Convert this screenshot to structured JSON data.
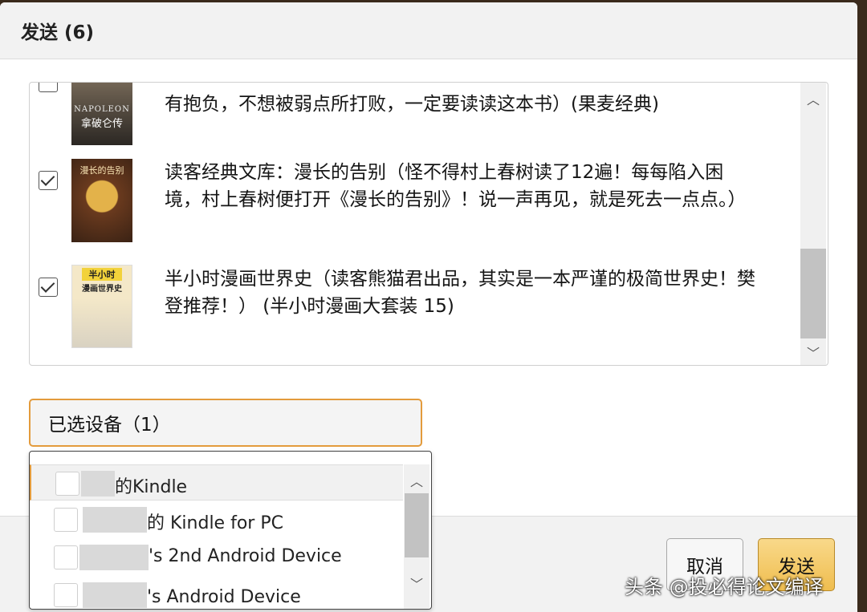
{
  "dialog": {
    "title": "发送 (6)"
  },
  "books": [
    {
      "title": "有抱负，不想被弱点所打败，一定要读读这本书）(果麦经典)",
      "checked": false,
      "cover_top": "NAPOLEON",
      "cover_bottom": "拿破仑传"
    },
    {
      "title": "读客经典文库：漫长的告别（怪不得村上春树读了12遍！每每陷入困境，村上春树便打开《漫长的告别》！说一声再见，就是死去一点点。）",
      "checked": true,
      "cover_top": "漫长的告别"
    },
    {
      "title": "半小时漫画世界史（读客熊猫君出品，其实是一本严谨的极简世界史！樊登推荐！） (半小时漫画大套装 15)",
      "checked": true,
      "cover_top": "半小时",
      "cover_bottom": "漫画世界史"
    }
  ],
  "devices": {
    "button_label": "已选设备（1）",
    "items": [
      {
        "label": "的Kindle"
      },
      {
        "label": "的 Kindle for PC"
      },
      {
        "label": "'s 2nd Android Device"
      },
      {
        "label": "'s Android Device"
      }
    ]
  },
  "footer": {
    "cancel_label": "取消",
    "send_label": "发送"
  },
  "watermark": "头条 @投必得论文编译"
}
